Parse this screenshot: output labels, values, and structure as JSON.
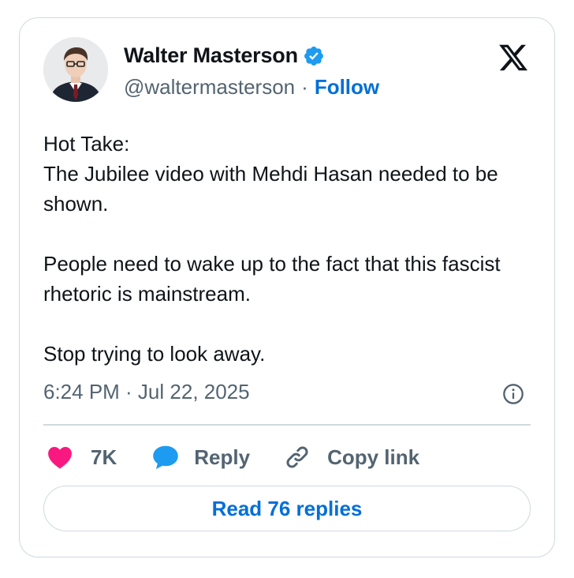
{
  "author": {
    "name": "Walter Masterson",
    "handle": "@waltermasterson",
    "separator": "·",
    "follow_label": "Follow"
  },
  "tweet": {
    "lines": [
      "Hot Take:",
      "The Jubilee video with Mehdi Hasan needed to be shown.",
      "People need to wake up to the fact that this fascist rhetoric is mainstream.",
      "Stop trying to look away."
    ],
    "timestamp": "6:24 PM · Jul 22, 2025"
  },
  "actions": {
    "like_count": "7K",
    "reply_label": "Reply",
    "copy_label": "Copy link",
    "read_replies_label": "Read 76 replies"
  },
  "icons": {
    "verified": "verified-badge-icon",
    "brand": "x-logo-icon",
    "info": "info-icon",
    "like": "heart-icon",
    "reply": "speech-bubble-icon",
    "copy": "link-icon"
  },
  "colors": {
    "accent": "#006fd6",
    "verified": "#1d9bf0",
    "like": "#f91880",
    "reply": "#1d9bf0",
    "text": "#0f1419",
    "muted": "#536471",
    "border": "#cfd9de"
  }
}
